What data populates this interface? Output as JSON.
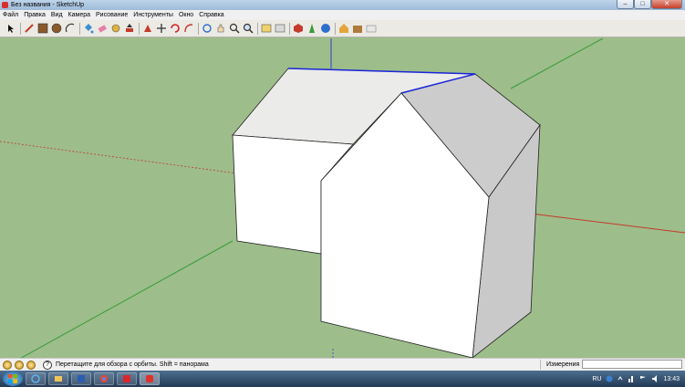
{
  "window": {
    "title": "Без названия - SketchUp",
    "minimize_label": "‒",
    "maximize_label": "□",
    "close_label": "✕"
  },
  "menu": {
    "items": [
      "Файл",
      "Правка",
      "Вид",
      "Камера",
      "Рисование",
      "Инструменты",
      "Окно",
      "Справка"
    ]
  },
  "toolbar": {
    "tools": [
      "select-icon",
      "pencil-icon",
      "rectangle-icon",
      "circle-icon",
      "arc-icon",
      "paint-bucket-icon",
      "eraser-icon",
      "tape-measure-icon",
      "push-pull-icon",
      "follow-me-icon",
      "move-icon",
      "rotate-icon",
      "offset-icon",
      "orbit-icon",
      "pan-icon",
      "zoom-icon",
      "zoom-extents-icon",
      "scenes-icon",
      "sections-icon",
      "components-icon",
      "position-camera-icon",
      "walk-icon",
      "look-around-icon",
      "warehouse-icon",
      "extension-icon",
      "share-icon"
    ]
  },
  "status": {
    "hint": "Перетащите для обзора с орбиты.  Shift = панорама",
    "measurements_label": "Измерения",
    "measurements_value": ""
  },
  "taskbar": {
    "language": "RU",
    "clock": "13:43"
  },
  "colors": {
    "ground": "#9dbd8b",
    "axis_red": "#c43b2b",
    "axis_green": "#3a9a3a",
    "axis_blue": "#2d3fcf",
    "edge_highlight": "#1a25d6"
  }
}
